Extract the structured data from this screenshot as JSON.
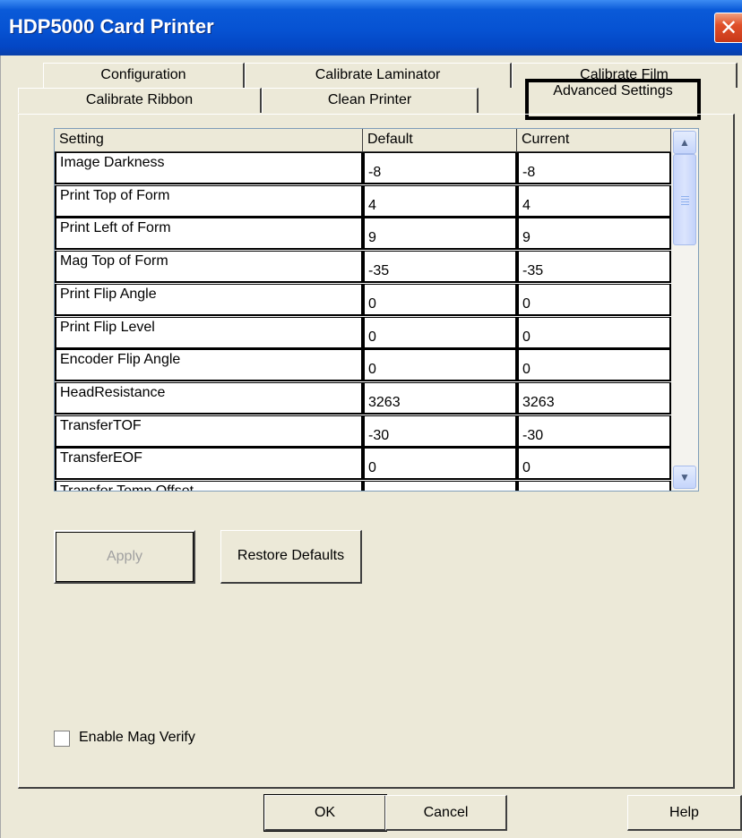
{
  "window": {
    "title": "HDP5000 Card Printer",
    "close_glyph": "✕"
  },
  "tabs_back": [
    {
      "label": "Configuration"
    },
    {
      "label": "Calibrate Laminator"
    },
    {
      "label": "Calibrate Film"
    }
  ],
  "tabs_front": [
    {
      "label": "Calibrate Ribbon"
    },
    {
      "label": "Clean Printer"
    },
    {
      "label": "Advanced Settings"
    }
  ],
  "grid": {
    "columns": [
      "Setting",
      "Default",
      "Current"
    ],
    "rows": [
      {
        "setting": "Image Darkness",
        "default": "-8",
        "current": "-8"
      },
      {
        "setting": "Print Top of Form",
        "default": "4",
        "current": "4"
      },
      {
        "setting": "Print Left of Form",
        "default": "9",
        "current": "9"
      },
      {
        "setting": "Mag Top of Form",
        "default": "-35",
        "current": "-35"
      },
      {
        "setting": "Print Flip Angle",
        "default": "0",
        "current": "0"
      },
      {
        "setting": "Print Flip Level",
        "default": "0",
        "current": "0"
      },
      {
        "setting": "Encoder Flip Angle",
        "default": "0",
        "current": "0"
      },
      {
        "setting": "HeadResistance",
        "default": "3263",
        "current": "3263"
      },
      {
        "setting": "TransferTOF",
        "default": "-30",
        "current": "-30"
      },
      {
        "setting": "TransferEOF",
        "default": "0",
        "current": "0"
      },
      {
        "setting": "Transfer Temp Offset",
        "default": "",
        "current": ""
      }
    ],
    "scroll_up_glyph": "▲",
    "scroll_down_glyph": "▼"
  },
  "actions": {
    "apply": "Apply",
    "restore": "Restore Defaults"
  },
  "options": {
    "enable_mag_verify": "Enable Mag Verify",
    "enable_mag_verify_checked": false
  },
  "footer": {
    "ok": "OK",
    "cancel": "Cancel",
    "help": "Help"
  }
}
